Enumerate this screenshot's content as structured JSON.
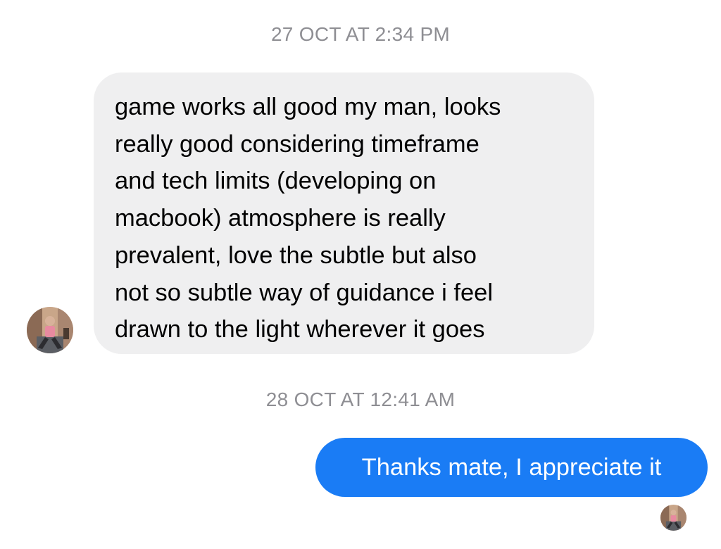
{
  "conversation": {
    "timestamps": [
      "27 OCT AT 2:34 PM",
      "28 OCT AT 12:41 AM"
    ],
    "messages": [
      {
        "direction": "incoming",
        "text": "game works all good my man, looks\nreally good considering timeframe\nand tech limits (developing on\nmacbook) atmosphere is really\nprevalent, love the subtle but also\nnot so subtle way of guidance i feel\ndrawn to the light wherever it goes"
      },
      {
        "direction": "outgoing",
        "text": "Thanks mate, I appreciate it"
      }
    ]
  },
  "colors": {
    "incoming_bubble": "#efeff0",
    "outgoing_bubble": "#1a7cf5",
    "timestamp_text": "#8e8e93"
  },
  "icons": {
    "contact_avatar": "contact-avatar-photo",
    "read_receipt": "read-receipt-avatar"
  }
}
